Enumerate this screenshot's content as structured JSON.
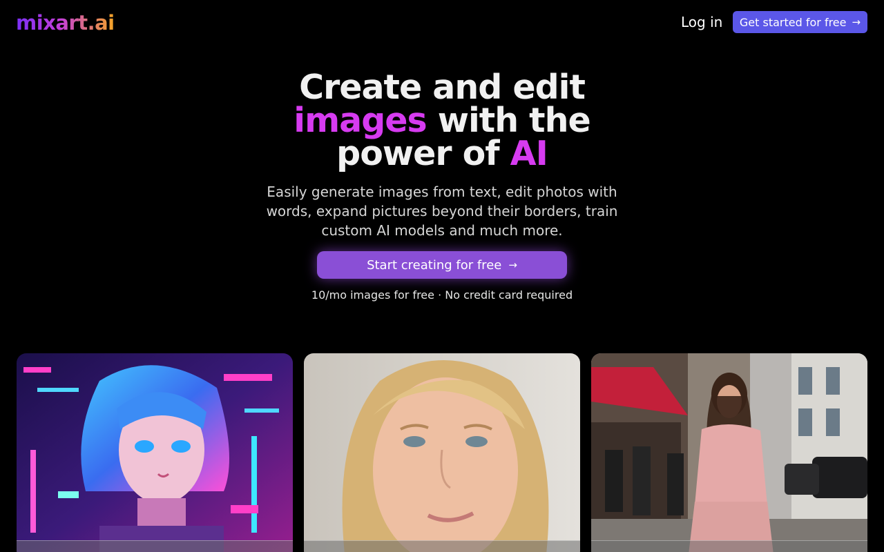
{
  "header": {
    "logo": "mixart.ai",
    "login_label": "Log in",
    "cta_label": "Get started for free"
  },
  "hero": {
    "title_line1": "Create and edit",
    "title_highlight1": "images",
    "title_line2_rest": " with the",
    "title_line3_prefix": "power of ",
    "title_highlight2": "AI",
    "subtitle": "Easily generate images from text, edit photos with words, expand pictures beyond their borders, train custom AI models and much more.",
    "cta_label": "Start creating for free",
    "note": "10/mo images for free · No credit card required"
  },
  "icons": {
    "arrow": "arrow-right-icon"
  },
  "colors": {
    "accent_top_button": "#5b57e8",
    "accent_main_button": "#8a4fd6",
    "highlight": "#d63bf0",
    "background": "#000000"
  }
}
